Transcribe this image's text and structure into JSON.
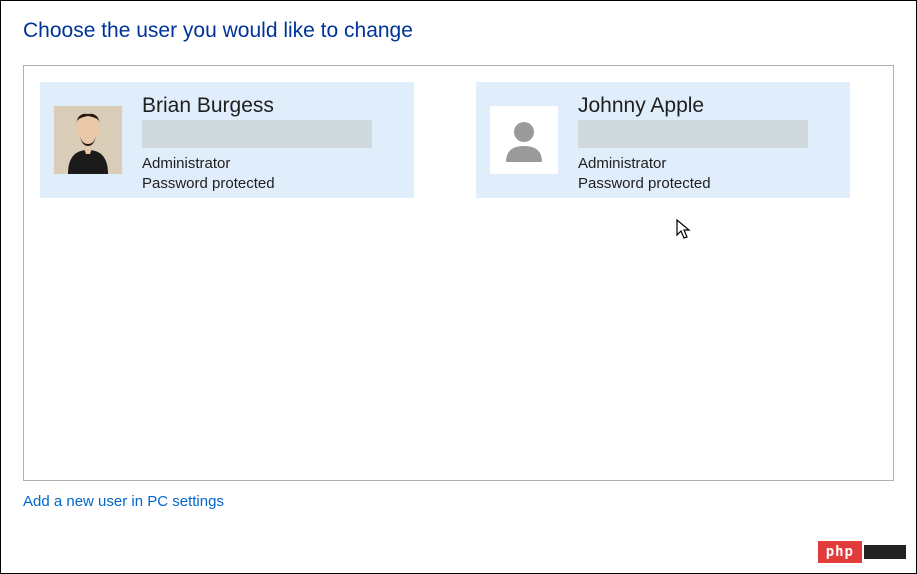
{
  "page": {
    "title": "Choose the user you would like to change",
    "add_user_link": "Add a new user in PC settings"
  },
  "users": [
    {
      "name": "Brian Burgess",
      "role": "Administrator",
      "status": "Password protected",
      "avatar_type": "photo"
    },
    {
      "name": "Johnny Apple",
      "role": "Administrator",
      "status": "Password protected",
      "avatar_type": "generic"
    }
  ],
  "badge": {
    "text": "php"
  }
}
